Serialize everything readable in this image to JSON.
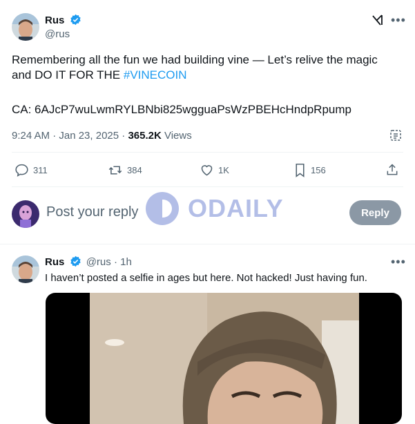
{
  "main_tweet": {
    "author_name": "Rus",
    "author_handle": "@rus",
    "text_line1": "Remembering all the fun we had building vine — Let’s relive the magic",
    "text_line2_prefix": "and DO IT FOR THE ",
    "hashtag": "#VINECOIN",
    "ca_line": "CA: 6AJcP7wuLwmRYLBNbi825wgguaPsWzPBEHcHndpRpump",
    "time": "9:24 AM · Jan 23, 2025 · ",
    "views_count": "365.2K",
    "views_label": " Views",
    "stats": {
      "replies": "311",
      "reposts": "384",
      "likes": "1K",
      "bookmarks": "156"
    }
  },
  "reply_box": {
    "placeholder": "Post your reply",
    "button_label": "Reply"
  },
  "watermark": {
    "text": "ODAILY"
  },
  "reply_tweet": {
    "author_name": "Rus",
    "author_handle": "@rus",
    "time": "· 1h",
    "text": "I haven’t posted a selfie in ages but here. Not hacked! Just having fun."
  },
  "colors": {
    "accent": "#1d9bf0",
    "reply_button_bg": "#8b98a5",
    "muted": "#536471"
  }
}
